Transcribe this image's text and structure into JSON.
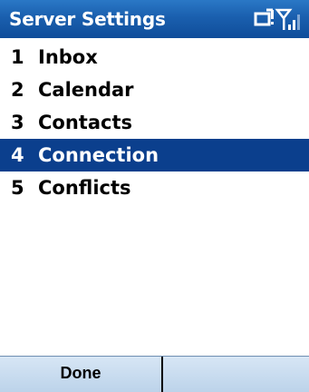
{
  "titlebar": {
    "title": "Server Settings",
    "icons": [
      "notification-icon",
      "signal-strength-icon"
    ]
  },
  "menu": {
    "items": [
      {
        "number": "1",
        "label": "Inbox",
        "selected": false
      },
      {
        "number": "2",
        "label": "Calendar",
        "selected": false
      },
      {
        "number": "3",
        "label": "Contacts",
        "selected": false
      },
      {
        "number": "4",
        "label": "Connection",
        "selected": true
      },
      {
        "number": "5",
        "label": "Conflicts",
        "selected": false
      }
    ]
  },
  "softkeys": {
    "left_label": "Done",
    "right_label": ""
  },
  "colors": {
    "titlebar": "#1a5fae",
    "selection": "#0b3f8d",
    "softkey_bar": "#c8dbef"
  }
}
